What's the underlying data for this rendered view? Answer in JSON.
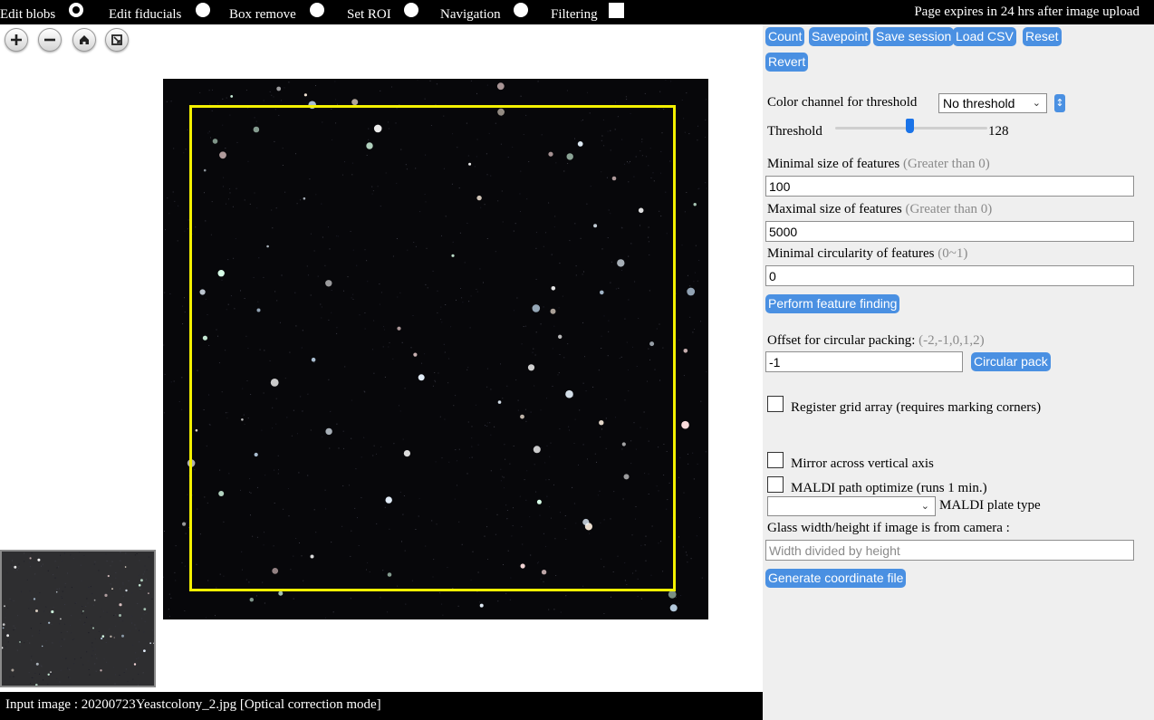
{
  "topbar": {
    "modes": [
      {
        "label": "Edit blobs",
        "selected": true
      },
      {
        "label": "Edit fiducials",
        "selected": false
      },
      {
        "label": "Box remove",
        "selected": false
      },
      {
        "label": "Set ROI",
        "selected": false
      },
      {
        "label": "Navigation",
        "selected": false
      }
    ],
    "filtering_label": "Filtering",
    "expires": "Page expires in 24 hrs after image upload"
  },
  "zoom": {
    "icons": [
      "zoom-in-icon",
      "zoom-out-icon",
      "home-icon",
      "fit-screen-icon"
    ]
  },
  "status": "Input image : 20200723Yeastcolony_2.jpg [Optical correction mode]",
  "panel": {
    "buttons": {
      "count": "Count",
      "savepoint": "Savepoint",
      "save_session": "Save session",
      "load_csv": "Load CSV",
      "reset": "Reset",
      "revert": "Revert"
    },
    "color_channel_label": "Color channel for threshold",
    "color_channel_value": "No threshold",
    "threshold_label": "Threshold",
    "threshold_value": "128",
    "min_size_label": "Minimal size of features",
    "min_size_hint": "(Greater than 0)",
    "min_size_value": "100",
    "max_size_label": "Maximal size of features",
    "max_size_hint": "(Greater than 0)",
    "max_size_value": "5000",
    "min_circ_label": "Minimal circularity of features",
    "min_circ_hint": "(0~1)",
    "min_circ_value": "0",
    "perform_button": "Perform feature finding",
    "offset_label": "Offset for circular packing:",
    "offset_hint": "(-2,-1,0,1,2)",
    "offset_value": "-1",
    "circular_pack_button": "Circular pack",
    "register_grid_label": "Register grid array (requires marking corners)",
    "mirror_label": "Mirror across vertical axis",
    "maldi_optimize_label": "MALDI path optimize (runs 1 min.)",
    "maldi_plate_label": "MALDI plate type",
    "glass_label": "Glass width/height if image is from camera :",
    "glass_placeholder": "Width divided by height",
    "generate_button": "Generate coordinate file"
  },
  "colors": {
    "accent": "#4a90e2",
    "roi": "#f3f000",
    "slider": "#1a73e8"
  }
}
